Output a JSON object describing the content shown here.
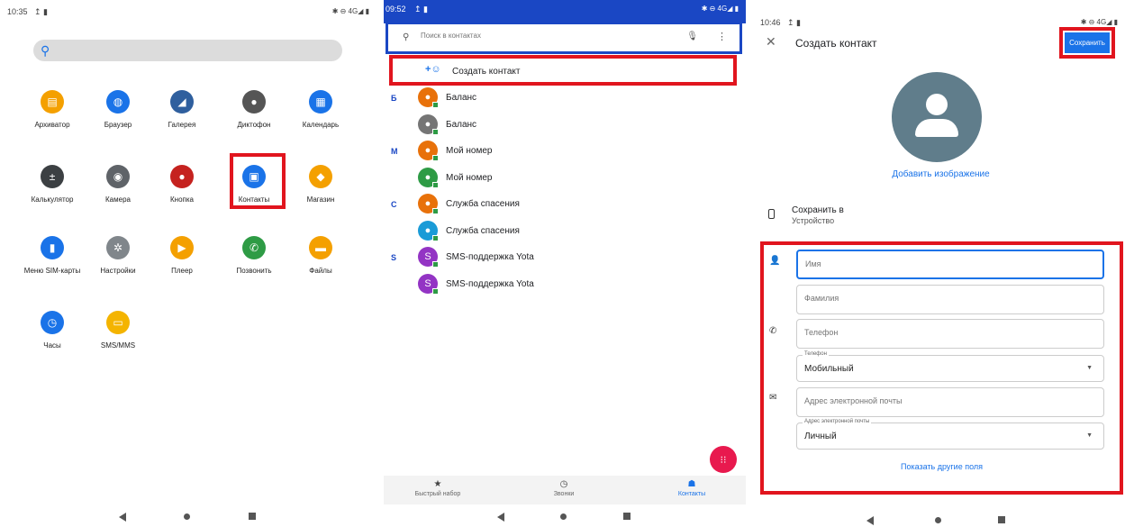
{
  "home": {
    "time": "10:35",
    "status_left": "↥ ▮",
    "status_right": "✱ ⊖ 4G◢ ▮",
    "apps": [
      {
        "label": "Архиватор",
        "icon": "archiver-icon",
        "color": "#f4a000",
        "glyph": "▤"
      },
      {
        "label": "Браузер",
        "icon": "globe-icon",
        "color": "#1a73e8",
        "glyph": "◍"
      },
      {
        "label": "Галерея",
        "icon": "gallery-icon",
        "color": "#2f5f9e",
        "glyph": "◢"
      },
      {
        "label": "Диктофон",
        "icon": "microphone-icon",
        "color": "#555555",
        "glyph": "●"
      },
      {
        "label": "Календарь",
        "icon": "calendar-icon",
        "color": "#1a73e8",
        "glyph": "▦"
      },
      {
        "label": "Калькулятор",
        "icon": "calculator-icon",
        "color": "#3c4043",
        "glyph": "±"
      },
      {
        "label": "Камера",
        "icon": "camera-icon",
        "color": "#5f6368",
        "glyph": "◉"
      },
      {
        "label": "Кнопка",
        "icon": "record-button-icon",
        "color": "#c5221f",
        "glyph": "●"
      },
      {
        "label": "Контакты",
        "icon": "contacts-icon",
        "color": "#1a73e8",
        "glyph": "▣"
      },
      {
        "label": "Магазин",
        "icon": "store-icon",
        "color": "#f4a000",
        "glyph": "◆"
      },
      {
        "label": "Меню SIM-карты",
        "icon": "sim-card-icon",
        "color": "#1a73e8",
        "glyph": "▮"
      },
      {
        "label": "Настройки",
        "icon": "gear-icon",
        "color": "#80868b",
        "glyph": "✲"
      },
      {
        "label": "Плеер",
        "icon": "player-icon",
        "color": "#f4a000",
        "glyph": "▶"
      },
      {
        "label": "Позвонить",
        "icon": "phone-icon",
        "color": "#2e9b45",
        "glyph": "✆"
      },
      {
        "label": "Файлы",
        "icon": "folder-icon",
        "color": "#f4a000",
        "glyph": "▬"
      },
      {
        "label": "Часы",
        "icon": "clock-icon",
        "color": "#1a73e8",
        "glyph": "◷"
      },
      {
        "label": "SMS/MMS",
        "icon": "message-icon",
        "color": "#f4b400",
        "glyph": "▭"
      }
    ]
  },
  "contacts": {
    "time": "09:52",
    "status_left": "↥ ▮",
    "status_right": "✱ ⊖ 4G◢ ▮",
    "search_placeholder": "Поиск в контактах",
    "create_label": "Создать контакт",
    "rows": [
      {
        "letter": "Б",
        "name": "Баланс",
        "color": "#e8710a",
        "glyph": "●"
      },
      {
        "letter": "",
        "name": "Баланс",
        "color": "#757575",
        "glyph": "●"
      },
      {
        "letter": "М",
        "name": "Мой номер",
        "color": "#e8710a",
        "glyph": "●"
      },
      {
        "letter": "",
        "name": "Мой номер",
        "color": "#2e9b45",
        "glyph": "●"
      },
      {
        "letter": "С",
        "name": "Служба спасения",
        "color": "#e8710a",
        "glyph": "●"
      },
      {
        "letter": "",
        "name": "Служба спасения",
        "color": "#1a9bd7",
        "glyph": "●"
      },
      {
        "letter": "S",
        "name": "SMS-поддержка Yota",
        "color": "#9334c4",
        "glyph": "S"
      },
      {
        "letter": "",
        "name": "SMS-поддержка Yota",
        "color": "#9334c4",
        "glyph": "S"
      }
    ],
    "bottom_nav": [
      {
        "label": "Быстрый набор",
        "icon": "star-icon",
        "glyph": "★"
      },
      {
        "label": "Звонки",
        "icon": "clock-icon",
        "glyph": "◷"
      },
      {
        "label": "Контакты",
        "icon": "people-icon",
        "glyph": "☗"
      }
    ]
  },
  "create": {
    "time": "10:46",
    "status_left": "↥ ▮",
    "status_right": "✱ ⊖ 4G◢ ▮",
    "title": "Создать контакт",
    "save_label": "Сохранить",
    "add_image": "Добавить изображение",
    "save_to_label": "Сохранить в",
    "save_to_value": "Устройство",
    "first_name_placeholder": "Имя",
    "last_name_placeholder": "Фамилия",
    "phone_placeholder": "Телефон",
    "phone_type_label": "Телефон",
    "phone_type_value": "Мобильный",
    "email_placeholder": "Адрес электронной почты",
    "email_type_label": "Адрес электронной почты",
    "email_type_value": "Личный",
    "show_more": "Показать другие поля"
  }
}
